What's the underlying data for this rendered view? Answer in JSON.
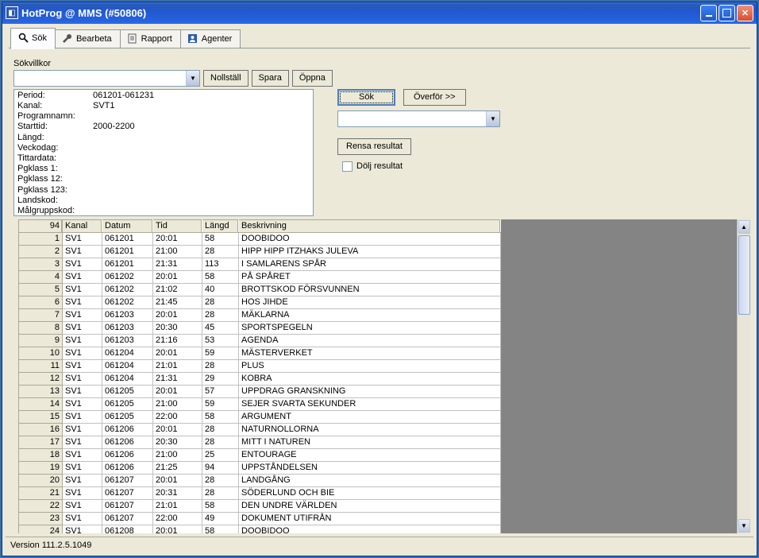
{
  "window": {
    "title": "HotProg @ MMS (#50806)"
  },
  "tabs": [
    {
      "label": "Sök",
      "icon": "search"
    },
    {
      "label": "Bearbeta",
      "icon": "wrench"
    },
    {
      "label": "Rapport",
      "icon": "report"
    },
    {
      "label": "Agenter",
      "icon": "agent"
    }
  ],
  "criteria": {
    "section_label": "Sökvillkor",
    "reset": "Nollställ",
    "save": "Spara",
    "open": "Öppna"
  },
  "summary": [
    {
      "label": "Period:",
      "value": "061201-061231"
    },
    {
      "label": "Kanal:",
      "value": "SVT1"
    },
    {
      "label": "Programnamn:",
      "value": ""
    },
    {
      "label": "Starttid:",
      "value": "2000-2200"
    },
    {
      "label": "Längd:",
      "value": ""
    },
    {
      "label": "Veckodag:",
      "value": ""
    },
    {
      "label": "Tittardata:",
      "value": ""
    },
    {
      "label": "Pgklass 1:",
      "value": ""
    },
    {
      "label": "Pgklass 12:",
      "value": ""
    },
    {
      "label": "Pgklass 123:",
      "value": ""
    },
    {
      "label": "Landskod:",
      "value": ""
    },
    {
      "label": "Målgruppskod:",
      "value": ""
    }
  ],
  "actions": {
    "search": "Sök",
    "transfer": "Överför >>",
    "clear": "Rensa resultat",
    "hide": "Dölj resultat"
  },
  "table": {
    "count": "94",
    "headers": {
      "kanal": "Kanal",
      "datum": "Datum",
      "tid": "Tid",
      "langd": "Längd",
      "beskr": "Beskrivning"
    },
    "rows": [
      {
        "n": "1",
        "kanal": "SV1",
        "datum": "061201",
        "tid": "20:01",
        "langd": "58",
        "beskr": "DOOBIDOO"
      },
      {
        "n": "2",
        "kanal": "SV1",
        "datum": "061201",
        "tid": "21:00",
        "langd": "28",
        "beskr": "HIPP HIPP ITZHAKS JULEVA"
      },
      {
        "n": "3",
        "kanal": "SV1",
        "datum": "061201",
        "tid": "21:31",
        "langd": "113",
        "beskr": "I SAMLARENS SPÅR"
      },
      {
        "n": "4",
        "kanal": "SV1",
        "datum": "061202",
        "tid": "20:01",
        "langd": "58",
        "beskr": "PÅ SPÅRET"
      },
      {
        "n": "5",
        "kanal": "SV1",
        "datum": "061202",
        "tid": "21:02",
        "langd": "40",
        "beskr": "BROTTSKOD FÖRSVUNNEN"
      },
      {
        "n": "6",
        "kanal": "SV1",
        "datum": "061202",
        "tid": "21:45",
        "langd": "28",
        "beskr": "HOS JIHDE"
      },
      {
        "n": "7",
        "kanal": "SV1",
        "datum": "061203",
        "tid": "20:01",
        "langd": "28",
        "beskr": "MÄKLARNA"
      },
      {
        "n": "8",
        "kanal": "SV1",
        "datum": "061203",
        "tid": "20:30",
        "langd": "45",
        "beskr": "SPORTSPEGELN"
      },
      {
        "n": "9",
        "kanal": "SV1",
        "datum": "061203",
        "tid": "21:16",
        "langd": "53",
        "beskr": "AGENDA"
      },
      {
        "n": "10",
        "kanal": "SV1",
        "datum": "061204",
        "tid": "20:01",
        "langd": "59",
        "beskr": "MÄSTERVERKET"
      },
      {
        "n": "11",
        "kanal": "SV1",
        "datum": "061204",
        "tid": "21:01",
        "langd": "28",
        "beskr": "PLUS"
      },
      {
        "n": "12",
        "kanal": "SV1",
        "datum": "061204",
        "tid": "21:31",
        "langd": "29",
        "beskr": "KOBRA"
      },
      {
        "n": "13",
        "kanal": "SV1",
        "datum": "061205",
        "tid": "20:01",
        "langd": "57",
        "beskr": "UPPDRAG GRANSKNING"
      },
      {
        "n": "14",
        "kanal": "SV1",
        "datum": "061205",
        "tid": "21:00",
        "langd": "59",
        "beskr": "SEJER SVARTA SEKUNDER"
      },
      {
        "n": "15",
        "kanal": "SV1",
        "datum": "061205",
        "tid": "22:00",
        "langd": "58",
        "beskr": "ARGUMENT"
      },
      {
        "n": "16",
        "kanal": "SV1",
        "datum": "061206",
        "tid": "20:01",
        "langd": "28",
        "beskr": "NATURNOLLORNA"
      },
      {
        "n": "17",
        "kanal": "SV1",
        "datum": "061206",
        "tid": "20:30",
        "langd": "28",
        "beskr": "MITT I NATUREN"
      },
      {
        "n": "18",
        "kanal": "SV1",
        "datum": "061206",
        "tid": "21:00",
        "langd": "25",
        "beskr": "ENTOURAGE"
      },
      {
        "n": "19",
        "kanal": "SV1",
        "datum": "061206",
        "tid": "21:25",
        "langd": "94",
        "beskr": "UPPSTÅNDELSEN"
      },
      {
        "n": "20",
        "kanal": "SV1",
        "datum": "061207",
        "tid": "20:01",
        "langd": "28",
        "beskr": "LANDGÅNG"
      },
      {
        "n": "21",
        "kanal": "SV1",
        "datum": "061207",
        "tid": "20:31",
        "langd": "28",
        "beskr": "SÖDERLUND OCH BIE"
      },
      {
        "n": "22",
        "kanal": "SV1",
        "datum": "061207",
        "tid": "21:01",
        "langd": "58",
        "beskr": "DEN UNDRE VÄRLDEN"
      },
      {
        "n": "23",
        "kanal": "SV1",
        "datum": "061207",
        "tid": "22:00",
        "langd": "49",
        "beskr": "DOKUMENT UTIFRÅN"
      },
      {
        "n": "24",
        "kanal": "SV1",
        "datum": "061208",
        "tid": "20:01",
        "langd": "58",
        "beskr": "DOOBIDOO"
      }
    ]
  },
  "status": {
    "version": "Version 111.2.5.1049"
  }
}
